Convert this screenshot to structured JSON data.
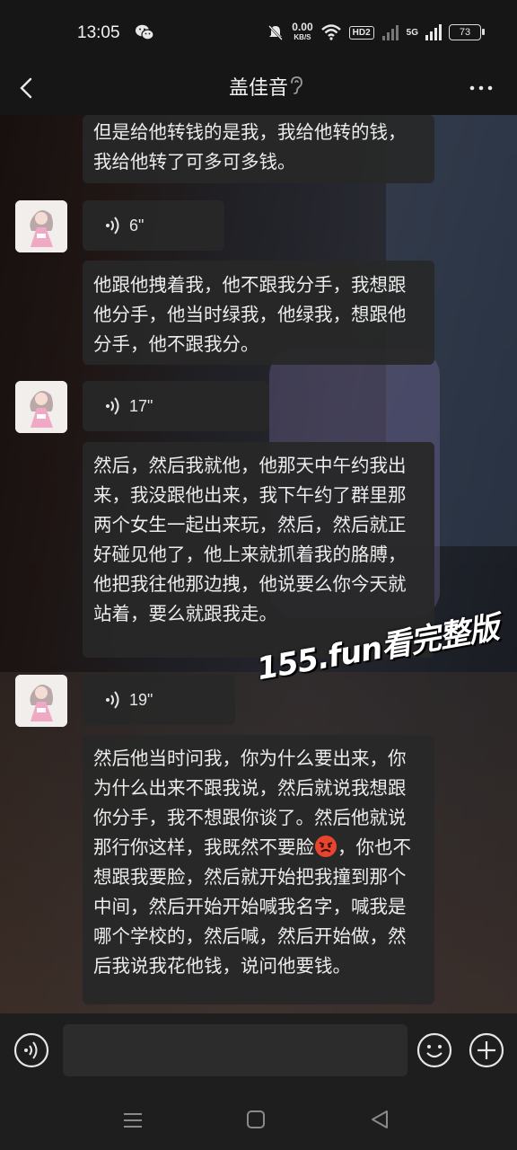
{
  "status_bar": {
    "time": "13:05",
    "net_speed_value": "0.00",
    "net_speed_unit": "KB/S",
    "hd_label": "HD2",
    "signal_label": "5G",
    "battery": "73",
    "icons": [
      "wechat-icon",
      "mute-icon",
      "wifi-icon",
      "signal-icon"
    ]
  },
  "header": {
    "title": "盖佳音",
    "icons": [
      "back-icon",
      "ear-icon",
      "more-icon"
    ]
  },
  "messages": [
    {
      "type": "text",
      "text": "但是给他转钱的是我，我给他转的钱，我给他转了可多可多钱。"
    },
    {
      "type": "voice",
      "duration": "6\""
    },
    {
      "type": "text",
      "text": "他跟他拽着我，他不跟我分手，我想跟他分手，他当时绿我，他绿我，想跟他分手，他不跟我分。"
    },
    {
      "type": "voice",
      "duration": "17\""
    },
    {
      "type": "text",
      "text": "然后，然后我就他，他那天中午约我出来，我没跟他出来，我下午约了群里那两个女生一起出来玩，然后，然后就正好碰见他了，他上来就抓着我的胳膊，他把我往他那边拽，他说要么你今天就站着，要么就跟我走。"
    },
    {
      "type": "voice",
      "duration": "19\""
    },
    {
      "type": "text",
      "text_before_emoji": "然后他当时问我，你为什么要出来，你为什么出来不跟我说，然后就说我想跟你分手，我不想跟你谈了。然后他就说那行你这样，我既然不要脸",
      "emoji": "angry-face-icon",
      "text_after_emoji": "，你也不想跟我要脸，然后就开始把我撞到那个中间，然后开始开始喊我名字，喊我是哪个学校的，然后喊，然后开始做，然后我说我花他钱，说问他要钱。"
    }
  ],
  "watermark": "155.fun看完整版",
  "input_bar": {
    "placeholder": "",
    "icons": [
      "voice-toggle-icon",
      "emoji-icon",
      "plus-icon"
    ]
  },
  "nav_bar": {
    "icons": [
      "menu-icon",
      "home-icon",
      "back-triangle-icon"
    ]
  },
  "colors": {
    "bubble_bg": "#282828",
    "bar_bg": "#1e1e1e",
    "text": "#ececec"
  }
}
